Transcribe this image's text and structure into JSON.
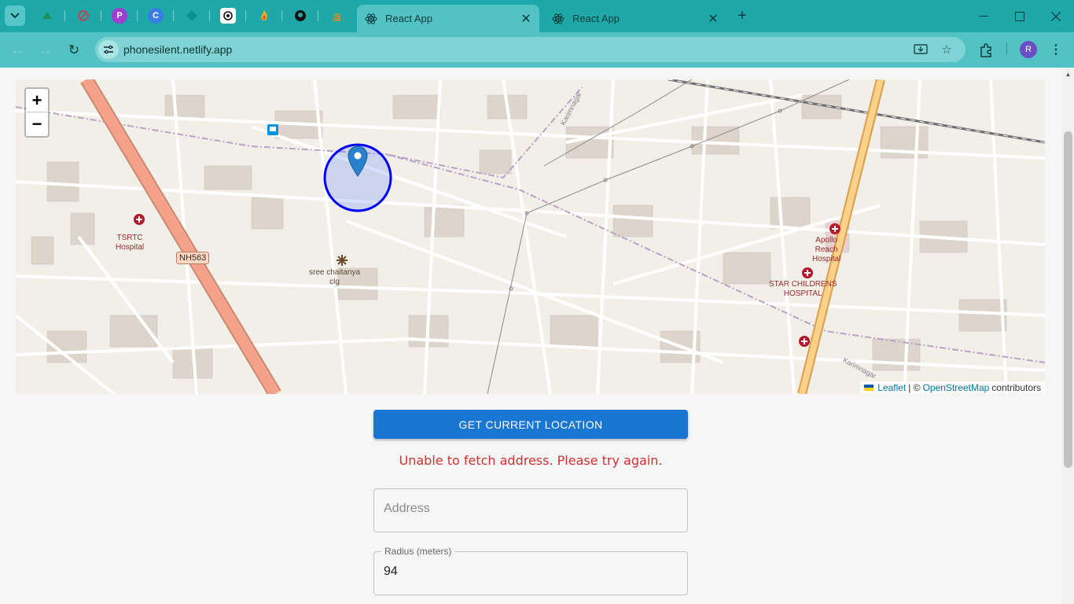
{
  "browser": {
    "tabs": [
      {
        "title": "React App"
      },
      {
        "title": "React App"
      }
    ],
    "url": "phonesilent.netlify.app",
    "profile_initial": "R",
    "accent": "#1fa8a8"
  },
  "map": {
    "labels": {
      "hospital_tsrtc": "TSRTC\nHospital",
      "road_shield": "NH563",
      "college": "sree chaitanya\nclg",
      "apollo": "Apollo\nReach\nHospital",
      "star": "STAR CHILDRENS\nHOSPITAL",
      "street_top": "Karimnagar",
      "street_bottom": "Karimnagar"
    },
    "zoom_in": "+",
    "zoom_out": "−",
    "attribution": {
      "leaflet": "Leaflet",
      "separator": "| ©",
      "osm": "OpenStreetMap",
      "contributors": "contributors"
    },
    "marker_color": "#2a81cb",
    "circle_color": "#0000ff"
  },
  "form": {
    "get_location_label": "GET CURRENT LOCATION",
    "error_message": "Unable to fetch address. Please try again.",
    "address_placeholder": "Address",
    "address_value": "",
    "radius_label": "Radius (meters)",
    "radius_value": "94"
  }
}
